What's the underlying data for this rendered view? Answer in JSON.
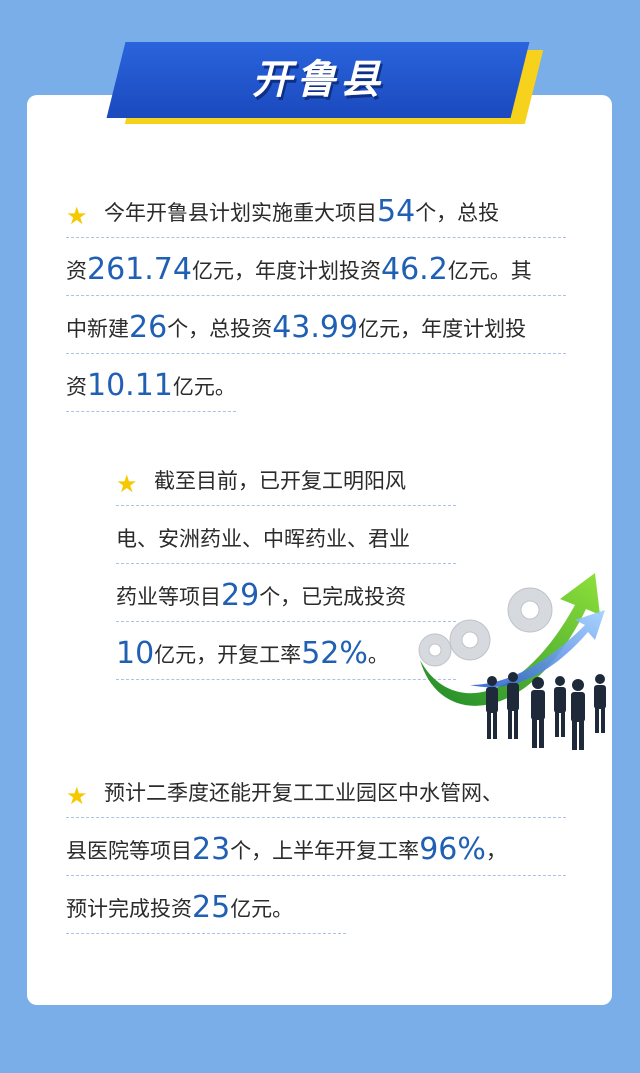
{
  "header": {
    "title": "开鲁县"
  },
  "paragraphs": {
    "p1": {
      "l1": {
        "a": "今年开鲁县计划实施重大项目",
        "n1": "54",
        "b": "个，总投"
      },
      "l2": {
        "a": "资",
        "n1": "261.74",
        "b": "亿元，年度计划投资",
        "n2": "46.2",
        "c": "亿元。其"
      },
      "l3": {
        "a": "中新建",
        "n1": "26",
        "b": "个，总投资",
        "n2": "43.99",
        "c": "亿元，年度计划投"
      },
      "l4": {
        "a": "资",
        "n1": "10.11",
        "b": "亿元。"
      }
    },
    "p2": {
      "l1": {
        "a": "截至目前，已开复工明阳风"
      },
      "l2": {
        "a": "电、安洲药业、中晖药业、君业"
      },
      "l3": {
        "a": "药业等项目",
        "n1": "29",
        "b": "个，已完成投资"
      },
      "l4": {
        "n1": "10",
        "b": "亿元，开复工率",
        "n2": "52%",
        "c": "。"
      }
    },
    "p3": {
      "l1": {
        "a": "预计二季度还能开复工工业园区中水管网、"
      },
      "l2": {
        "a": "县医院等项目",
        "n1": "23",
        "b": "个，上半年开复工率",
        "n2": "96%",
        "c": "，"
      },
      "l3": {
        "a": "预计完成投资",
        "n1": "25",
        "b": "亿元。"
      }
    }
  },
  "icons": {
    "bullet": "star-icon",
    "illustration": "business-growth-arrow-icon"
  },
  "colors": {
    "background": "#7aaee8",
    "banner": "#1b49be",
    "banner_accent": "#f7d21c",
    "highlight_number": "#1f5fb4",
    "star": "#f6c800"
  }
}
